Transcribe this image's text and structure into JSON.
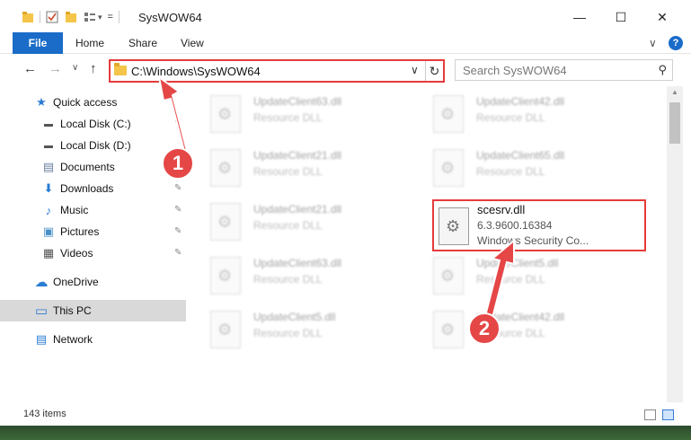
{
  "window": {
    "title": "SysWOW64",
    "minimize": "—",
    "maximize": "☐",
    "close": "✕"
  },
  "qat": {
    "dropdown": "="
  },
  "ribbon": {
    "tabs": [
      "File",
      "Home",
      "Share",
      "View"
    ],
    "help": "?",
    "collapse": "∨"
  },
  "nav": {
    "back": "←",
    "forward": "→",
    "recent": "∨",
    "up": "↑",
    "address": "C:\\Windows\\SysWOW64",
    "address_dropdown": "∨",
    "refresh": "↻",
    "search_placeholder": "Search SysWOW64"
  },
  "sidebar": {
    "items": [
      {
        "label": "Quick access",
        "icon": "star-icon",
        "glyph": "★"
      },
      {
        "label": "Local Disk (C:)",
        "icon": "drive-icon",
        "glyph": "▬"
      },
      {
        "label": "Local Disk (D:)",
        "icon": "drive-icon",
        "glyph": "▬"
      },
      {
        "label": "Documents",
        "icon": "document-icon",
        "glyph": "▤"
      },
      {
        "label": "Downloads",
        "icon": "download-arrow-icon",
        "glyph": "⬇"
      },
      {
        "label": "Music",
        "icon": "music-note-icon",
        "glyph": "♪"
      },
      {
        "label": "Pictures",
        "icon": "pictures-icon",
        "glyph": "▣"
      },
      {
        "label": "Videos",
        "icon": "film-icon",
        "glyph": "▦"
      },
      {
        "label": "OneDrive",
        "icon": "cloud-icon",
        "glyph": "☁"
      },
      {
        "label": "This PC",
        "icon": "computer-icon",
        "glyph": "▭"
      },
      {
        "label": "Network",
        "icon": "network-icon",
        "glyph": "▤"
      }
    ],
    "pin": "📌"
  },
  "files": {
    "left": [
      {
        "name": "UpdateClient63.dll",
        "desc": "Resource DLL"
      },
      {
        "name": "UpdateClient21.dll",
        "desc": "Resource DLL"
      },
      {
        "name": "UpdateClient21.dll",
        "desc": "Resource DLL"
      },
      {
        "name": "UpdateClient63.dll",
        "desc": "Resource DLL"
      },
      {
        "name": "UpdateClient5.dll",
        "desc": "Resource DLL"
      }
    ],
    "right": [
      {
        "name": "UpdateClient42.dll",
        "desc": "Resource DLL"
      },
      {
        "name": "UpdateClient65.dll",
        "desc": "Resource DLL"
      },
      {
        "name": "UpdateClient5.dll",
        "desc": "Resource DLL"
      },
      {
        "name": "UpdateClient42.dll",
        "desc": "Resource DLL"
      }
    ],
    "focus": {
      "name": "scesrv.dll",
      "version": "6.3.9600.16384",
      "desc": "Windows Security Co..."
    }
  },
  "status": {
    "count": "143 items"
  },
  "callouts": [
    "1",
    "2"
  ],
  "colors": {
    "accent": "#1a6cc8",
    "highlight": "#e53b3b",
    "selected": "#d9d9d9"
  }
}
